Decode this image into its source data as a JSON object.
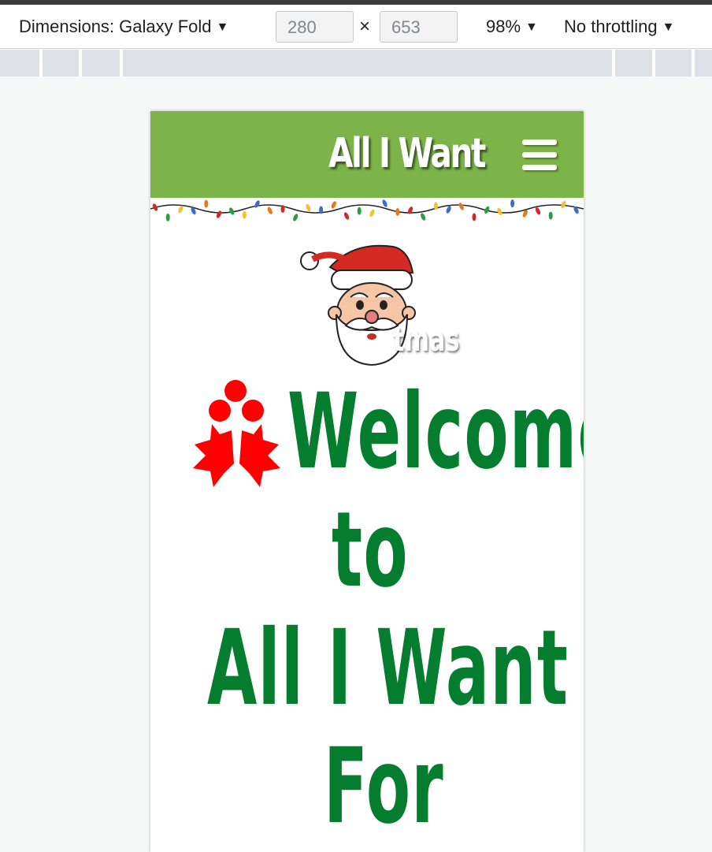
{
  "devtools": {
    "dimensions_label": "Dimensions: Galaxy Fold",
    "width_value": "280",
    "height_value": "653",
    "times_symbol": "×",
    "zoom_label": "98%",
    "throttling_label": "No throttling",
    "caret": "▼"
  },
  "site": {
    "brand": "All I Want",
    "logo_overlay_text": "tmas",
    "heading": [
      "Welcome",
      "to",
      "All I Want",
      "For"
    ],
    "colors": {
      "navbar": "#7cb449",
      "heading": "#047d2e",
      "holly": "#ff0000"
    },
    "icons": [
      "hamburger-menu-icon",
      "christmas-lights-icon",
      "santa-icon",
      "holly-icon"
    ]
  }
}
